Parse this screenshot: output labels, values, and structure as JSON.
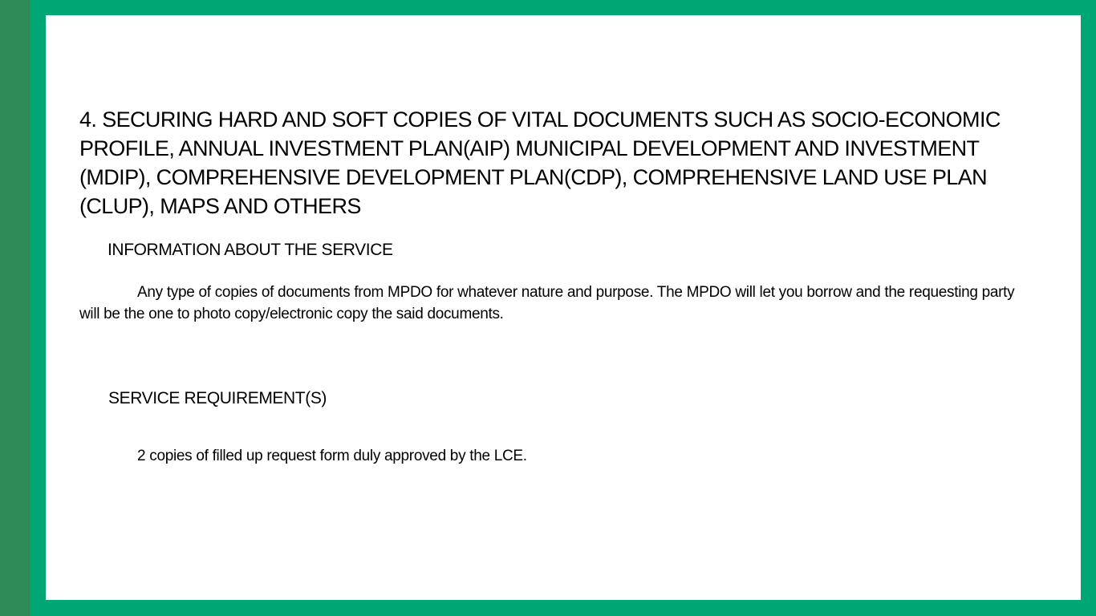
{
  "colors": {
    "side_stripe": "#2e8b57",
    "frame": "#00a775",
    "page": "#ffffff",
    "text": "#000000"
  },
  "document": {
    "title": "4. SECURING HARD AND SOFT COPIES OF VITAL DOCUMENTS SUCH AS SOCIO-ECONOMIC PROFILE, ANNUAL INVESTMENT PLAN(AIP)  MUNICIPAL DEVELOPMENT AND INVESTMENT (MDIP), COMPREHENSIVE DEVELOPMENT PLAN(CDP), COMPREHENSIVE LAND USE PLAN (CLUP), MAPS AND OTHERS",
    "info_heading": "INFORMATION ABOUT THE SERVICE",
    "info_text": "Any type of copies of documents from MPDO for whatever nature and purpose. The MPDO will let you borrow and the requesting party will be the one to photo copy/electronic copy the said documents.",
    "requirements_heading": "SERVICE REQUIREMENT(S)",
    "requirements_text": "2 copies of filled up request form duly approved by the LCE."
  }
}
